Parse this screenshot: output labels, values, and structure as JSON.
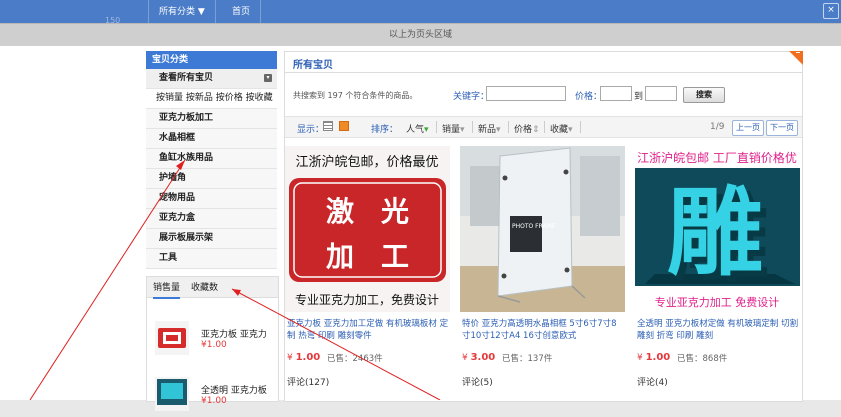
{
  "topbar": {
    "dim_text": "150",
    "nav_all_categories": "所有分类 ▼",
    "nav_home": "首页",
    "close_label": "×"
  },
  "header_band": {
    "text": "以上为页头区域"
  },
  "sidebar": {
    "title": "宝贝分类",
    "view_all": "查看所有宝贝",
    "toggle_glyph": "▾",
    "sort_links": "按销量 按新品 按价格 按收藏",
    "categories": [
      "亚克力板加工",
      "水晶相框",
      "鱼缸水族用品",
      "护墙角",
      "宠物用品",
      "亚克力盒",
      "展示板展示架",
      "工具"
    ],
    "tabs": [
      "销售量",
      "收藏数"
    ],
    "products": [
      {
        "name": "亚克力板 亚克力",
        "price": "¥1.00"
      },
      {
        "name": "全透明 亚克力板",
        "price": "¥1.00"
      }
    ]
  },
  "main": {
    "title": "所有宝贝",
    "result_text": "共搜索到 197 个符合条件的商品。",
    "keyword_label": "关键字：",
    "price_label": "价格：",
    "price_to": "到",
    "search_button": "搜索",
    "sortbar": {
      "display_label": "显示：",
      "sort_label": "排序：",
      "sort_options": [
        "人气",
        "销量",
        "新品",
        "价格",
        "收藏"
      ],
      "page_indicator": "1/9",
      "prev_page": "上一页",
      "next_page": "下一页"
    },
    "products": [
      {
        "banner_top": "江浙沪皖包邮，价格最优",
        "stamp_chars": [
          "激",
          "光",
          "加",
          "工"
        ],
        "banner_bottom": "专业亚克力加工，免费设计",
        "title": "亚克力板 亚克力加工定做 有机玻璃板材 定制 热弯 印刷 雕刻零件",
        "price_symbol": "¥ ",
        "price": "1.00",
        "sold": "已售：2463件",
        "comments": "评论(127)"
      },
      {
        "frame_text": "PHOTO FRAME",
        "title": "特价 亚克力高透明水晶相框 5寸6寸7寸8寸10寸12寸A4 16寸创意欧式",
        "price_symbol": "¥ ",
        "price": "3.00",
        "sold": "已售：137件",
        "comments": "评论(5)"
      },
      {
        "banner_top": "江浙沪皖包邮 工厂直销价格优",
        "carve_char": "雕",
        "banner_bottom": "专业亚克力加工  免费设计",
        "title": "全透明 亚克力板材定做 有机玻璃定制 切割雕刻 折弯 印刷 雕刻",
        "price_symbol": "¥ ",
        "price": "1.00",
        "sold": "已售：868件",
        "comments": "评论(4)"
      }
    ]
  },
  "colors": {
    "topbar": "#4a7cc7",
    "accent_blue": "#3d7ad6",
    "link_blue": "#2c5fb5",
    "price_red": "#e4393c",
    "corner_orange": "#f07020",
    "annotation_red": "#e02020"
  }
}
